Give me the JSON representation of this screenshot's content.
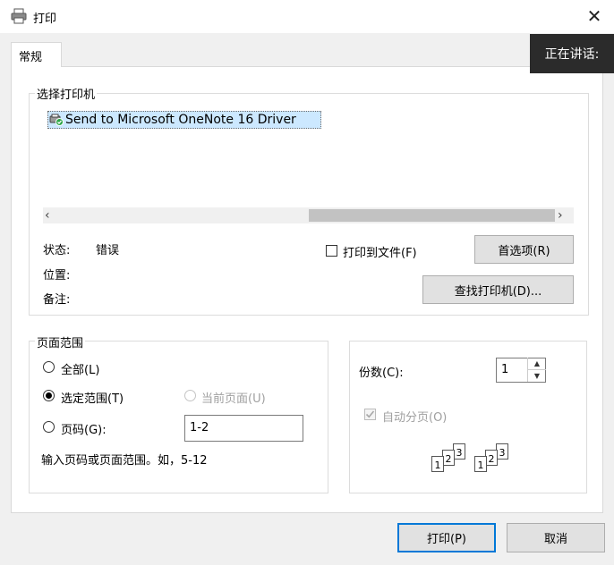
{
  "window": {
    "title": "打印"
  },
  "tabs": [
    {
      "label": "常规"
    }
  ],
  "speaking_badge": "正在讲话:",
  "printer_group": {
    "legend": "选择打印机",
    "printers": [
      {
        "name": "Send to Microsoft OneNote 16 Driver",
        "selected": true
      }
    ],
    "status_label": "状态:",
    "status_value": "错误",
    "location_label": "位置:",
    "comment_label": "备注:",
    "print_to_file_label": "打印到文件(F)",
    "print_to_file_checked": false,
    "preferences_button": "首选项(R)",
    "find_printer_button": "查找打印机(D)..."
  },
  "page_range": {
    "legend": "页面范围",
    "all_label": "全部(L)",
    "selection_label": "选定范围(T)",
    "current_page_label": "当前页面(U)",
    "pages_label": "页码(G):",
    "pages_value": "1-2",
    "hint": "输入页码或页面范围。如，5-12",
    "selected": "selection"
  },
  "copies": {
    "label": "份数(C):",
    "value": "1",
    "collate_label": "自动分页(O)",
    "collate_checked": true,
    "collate_disabled": true,
    "page_numbers": [
      "1",
      "2",
      "3"
    ]
  },
  "footer": {
    "print_button": "打印(P)",
    "cancel_button": "取消"
  }
}
